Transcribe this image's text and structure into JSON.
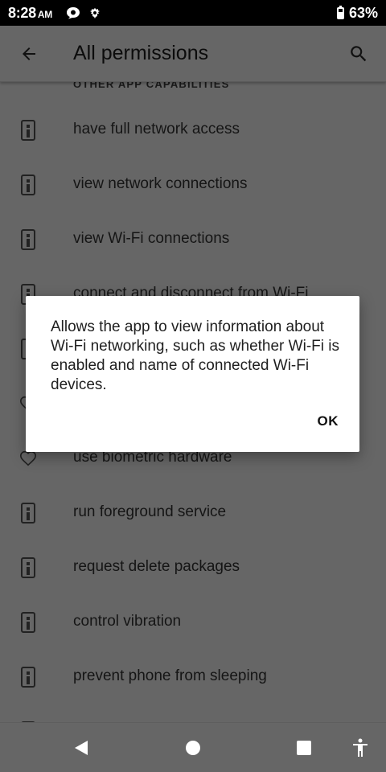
{
  "status_bar": {
    "time": "8:28",
    "ampm": "AM",
    "battery_percent": "63%",
    "battery_level": 0.63,
    "icons": [
      "chat-bubble-icon",
      "bug-icon",
      "battery-icon"
    ]
  },
  "app_bar": {
    "title": "All permissions",
    "back_icon": "arrow-back-icon",
    "search_icon": "search-icon"
  },
  "list": {
    "section_header": "OTHER APP CAPABILITIES",
    "items": [
      {
        "label": "have full network access",
        "icon": "info-icon"
      },
      {
        "label": "view network connections",
        "icon": "info-icon"
      },
      {
        "label": "view Wi-Fi connections",
        "icon": "info-icon"
      },
      {
        "label": "connect and disconnect from Wi-Fi",
        "icon": "info-icon"
      },
      {
        "label": "",
        "icon": "info-icon"
      },
      {
        "label": "",
        "icon": "heart-icon"
      },
      {
        "label": "use biometric hardware",
        "icon": "heart-icon"
      },
      {
        "label": "run foreground service",
        "icon": "info-icon"
      },
      {
        "label": "request delete packages",
        "icon": "info-icon"
      },
      {
        "label": "control vibration",
        "icon": "info-icon"
      },
      {
        "label": "prevent phone from sleeping",
        "icon": "info-icon"
      }
    ]
  },
  "dialog": {
    "message": "Allows the app to view information about Wi-Fi networking, such as whether Wi-Fi is enabled and name of connected Wi-Fi devices.",
    "ok_label": "OK"
  },
  "nav_bar": {
    "icons": [
      "nav-back-icon",
      "nav-home-icon",
      "nav-recents-icon",
      "accessibility-icon"
    ]
  }
}
